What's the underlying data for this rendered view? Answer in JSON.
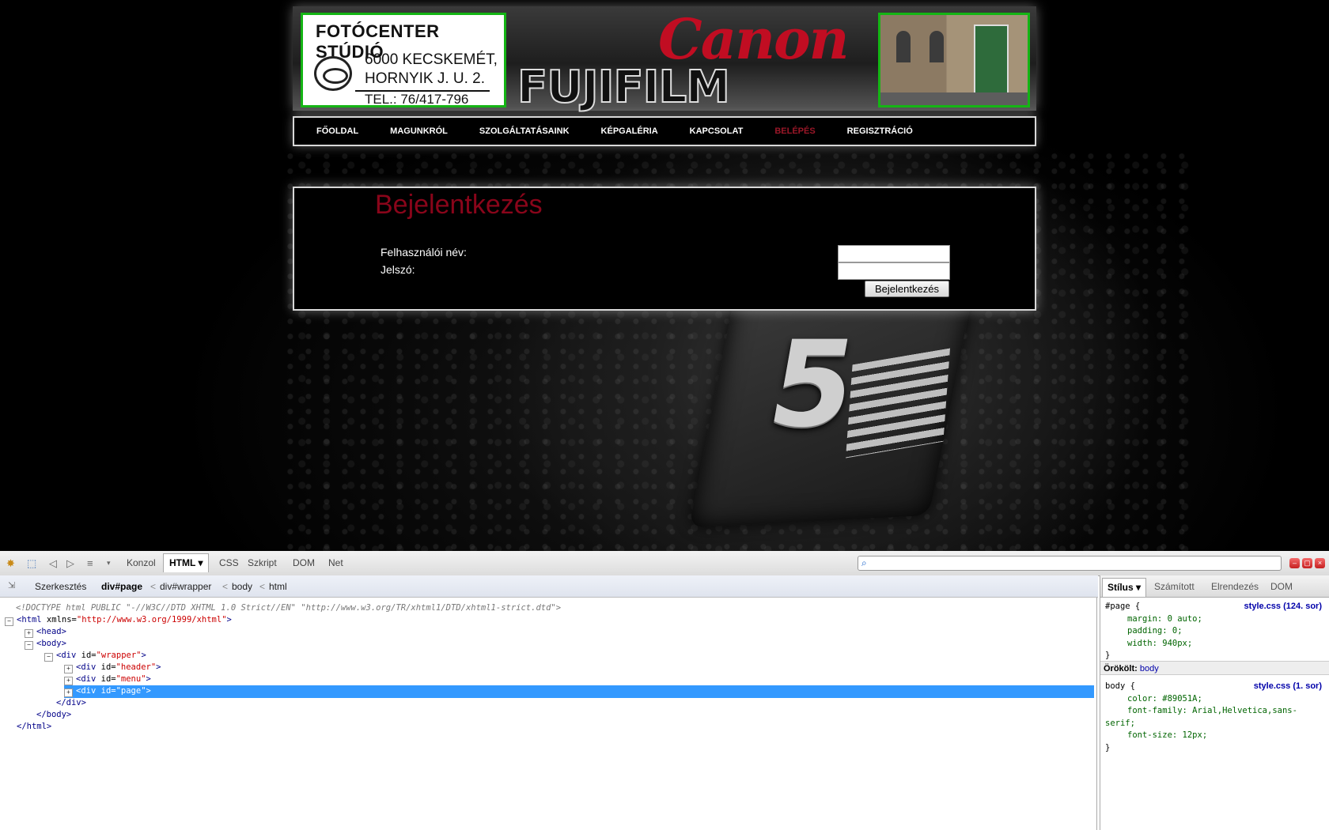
{
  "site": {
    "logo": {
      "title": "FOTÓCENTER STÚDIÓ",
      "line1": "6000 KECSKEMÉT,",
      "line2": "HORNYIK J. U. 2.",
      "line3": "TEL.: 76/417-796"
    },
    "brand1": "Canon",
    "brand2": "FUJIFILM",
    "camera_mark": "5",
    "menu": [
      "FŐOLDAL",
      "MAGUNKRÓL",
      "SZOLGÁLTATÁSAINK",
      "KÉPGALÉRIA",
      "KAPCSOLAT",
      "BELÉPÉS",
      "REGISZTRÁCIÓ"
    ],
    "active_menu": "BELÉPÉS",
    "login": {
      "title": "Bejelentkezés",
      "username_label": "Felhasználói név:",
      "password_label": "Jelszó:",
      "username_value": "",
      "password_value": "",
      "submit": "Bejelentkezés"
    },
    "colors": {
      "accent": "#89051A",
      "frame_green": "#14b514"
    }
  },
  "devtools": {
    "toolbar_tabs": [
      "Konzol",
      "HTML ▾",
      "CSS",
      "Szkript",
      "DOM",
      "Net"
    ],
    "active_tab": "HTML ▾",
    "search_value": "",
    "breadcrumb": {
      "edit": "Szerkesztés",
      "path": [
        "div#page",
        "div#wrapper",
        "body",
        "html"
      ]
    },
    "code": {
      "doctype": "<!DOCTYPE html PUBLIC \"-//W3C//DTD XHTML 1.0 Strict//EN\" \"http://www.w3.org/TR/xhtml1/DTD/xhtml1-strict.dtd\">",
      "html_open_tag": "<html",
      "xmlns_attr": " xmlns=",
      "xmlns_val": "\"http://www.w3.org/1999/xhtml\"",
      "gt": ">",
      "head": "<head>",
      "body": "<body>",
      "div_open": "<div",
      "id_attr": " id=",
      "wrapper_val": "\"wrapper\"",
      "header_val": "\"header\"",
      "menu_val": "\"menu\"",
      "page_val": "\"page\"",
      "div_close": "</div>",
      "body_close": "</body>",
      "html_close": "</html>"
    },
    "side": {
      "tabs": [
        "Stílus ▾",
        "Számított",
        "Elrendezés",
        "DOM"
      ],
      "active_tab": "Stílus ▾",
      "rule1": {
        "selector": "#page {",
        "source": "style.css (124. sor)",
        "props": [
          "margin: 0 auto;",
          "padding: 0;",
          "width: 940px;"
        ],
        "close": "}"
      },
      "inherited_label": "Örökölt:",
      "inherited_from": "body",
      "rule2": {
        "selector": "body {",
        "source": "style.css (1. sor)",
        "props": [
          "color: #89051A;",
          "font-family: Arial,Helvetica,sans-",
          "serif;",
          "font-size: 12px;"
        ],
        "close": "}"
      }
    }
  }
}
